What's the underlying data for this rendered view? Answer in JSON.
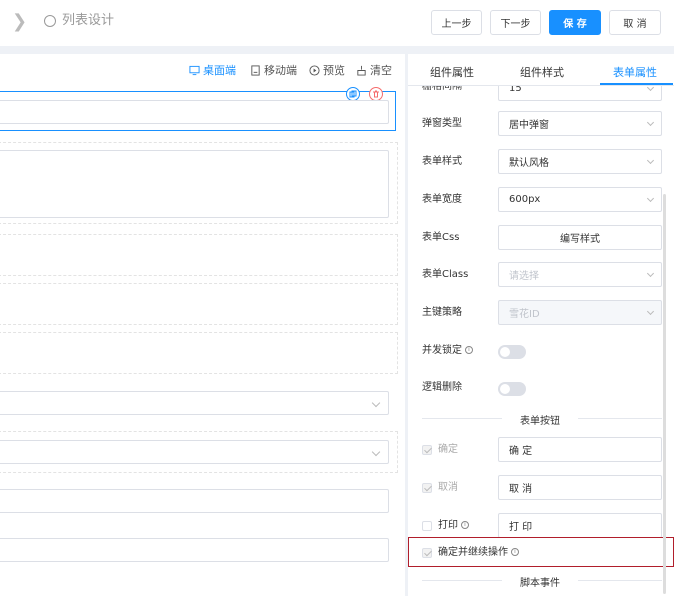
{
  "header": {
    "title": "列表设计",
    "prev_label": "上一步",
    "next_label": "下一步",
    "save_label": "保 存",
    "cancel_label": "取 消"
  },
  "canvas_toolbar": {
    "desktop_label": "桌面端",
    "mobile_label": "移动端",
    "preview_label": "预览",
    "clear_label": "清空"
  },
  "panel": {
    "tabs": [
      "组件属性",
      "组件样式",
      "表单属性"
    ],
    "active_tab": "表单属性",
    "partial_label": "栅格间隔",
    "partial_value": "15",
    "rows": {
      "popup_type": {
        "label": "弹窗类型",
        "value": "居中弹窗"
      },
      "form_style": {
        "label": "表单样式",
        "value": "默认风格"
      },
      "form_width": {
        "label": "表单宽度",
        "value": "600px"
      },
      "form_css": {
        "label": "表单Css",
        "button": "编写样式"
      },
      "form_class": {
        "label": "表单Class",
        "placeholder": "请选择"
      },
      "pk_strategy": {
        "label": "主键策略",
        "value": "雪花ID"
      },
      "concurrency_lock": {
        "label": "并发锁定"
      },
      "logical_delete": {
        "label": "逻辑删除"
      }
    },
    "buttons_section": "表单按钮",
    "buttons": [
      {
        "label": "确定",
        "value": "确 定",
        "checked": true
      },
      {
        "label": "取消",
        "value": "取 消",
        "checked": true
      },
      {
        "label": "打印",
        "value": "打 印",
        "checked": false
      }
    ],
    "confirm_continue_label": "确定并继续操作",
    "script_section": "脚本事件"
  },
  "colors": {
    "accent": "#1890ff",
    "highlight": "#b11e2b",
    "danger": "#f56c6c"
  }
}
